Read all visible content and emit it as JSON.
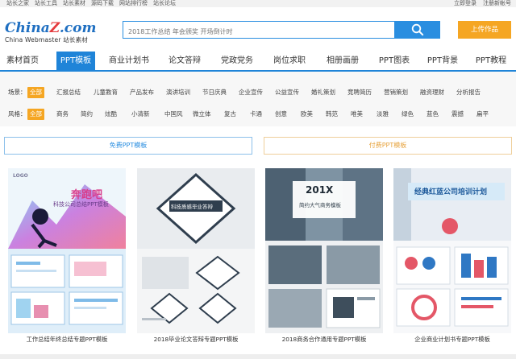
{
  "topbar": {
    "left_links": [
      "站长之家",
      "站长工具",
      "站长素材",
      "源码下载",
      "网站排行榜",
      "站长论坛"
    ],
    "login": "立即登录",
    "register": "注册新帐号"
  },
  "logo": {
    "brand_a": "China",
    "brand_z": "Z",
    "brand_b": ".com",
    "subtitle": "China Webmaster 站长素材"
  },
  "search": {
    "placeholder": "2018工作总结 年会颁奖 开场倒计时",
    "upload_label": "上传作品"
  },
  "nav": {
    "items": [
      "素材首页",
      "PPT模板",
      "商业计划书",
      "论文答辩",
      "党政党务",
      "岗位求职",
      "相册画册",
      "PPT图表",
      "PPT背景",
      "PPT教程"
    ]
  },
  "filters": {
    "scene_label": "场景：",
    "scene_options": [
      "全部",
      "汇报总结",
      "儿童教育",
      "产品发布",
      "演讲培训",
      "节日庆典",
      "企业宣传",
      "公益宣传",
      "婚礼策划",
      "竞聘简历",
      "营销策划",
      "融资理财",
      "分析报告"
    ],
    "style_label": "风格：",
    "style_options": [
      "全部",
      "商务",
      "简约",
      "炫酷",
      "小清新",
      "中国风",
      "微立体",
      "复古",
      "卡通",
      "创意",
      "欧美",
      "韩范",
      "唯美",
      "淡雅",
      "绿色",
      "蓝色",
      "震撼",
      "扁平"
    ]
  },
  "tabs": {
    "free": "免费PPT模板",
    "paid": "付费PPT模板"
  },
  "cards": [
    {
      "caption": "工作总结年终总结专题PPT模板",
      "thumb_title": "奔跑吧",
      "thumb_sub": "科技公司总结PPT模板",
      "thumb_logo": "LOGO"
    },
    {
      "caption": "2018毕业论文答辩专题PPT模板",
      "thumb_title": "科技质感毕业答辩",
      "thumb_sub": ""
    },
    {
      "caption": "2018商务合作通用专题PPT模板",
      "thumb_title": "201X",
      "thumb_sub": "简约大气商务模板"
    },
    {
      "caption": "企业商业计划书专题PPT模板",
      "thumb_title": "经典红蓝公司培训计划",
      "thumb_sub": ""
    }
  ],
  "colors": {
    "primary": "#1f84d8",
    "accent": "#f5a623"
  }
}
